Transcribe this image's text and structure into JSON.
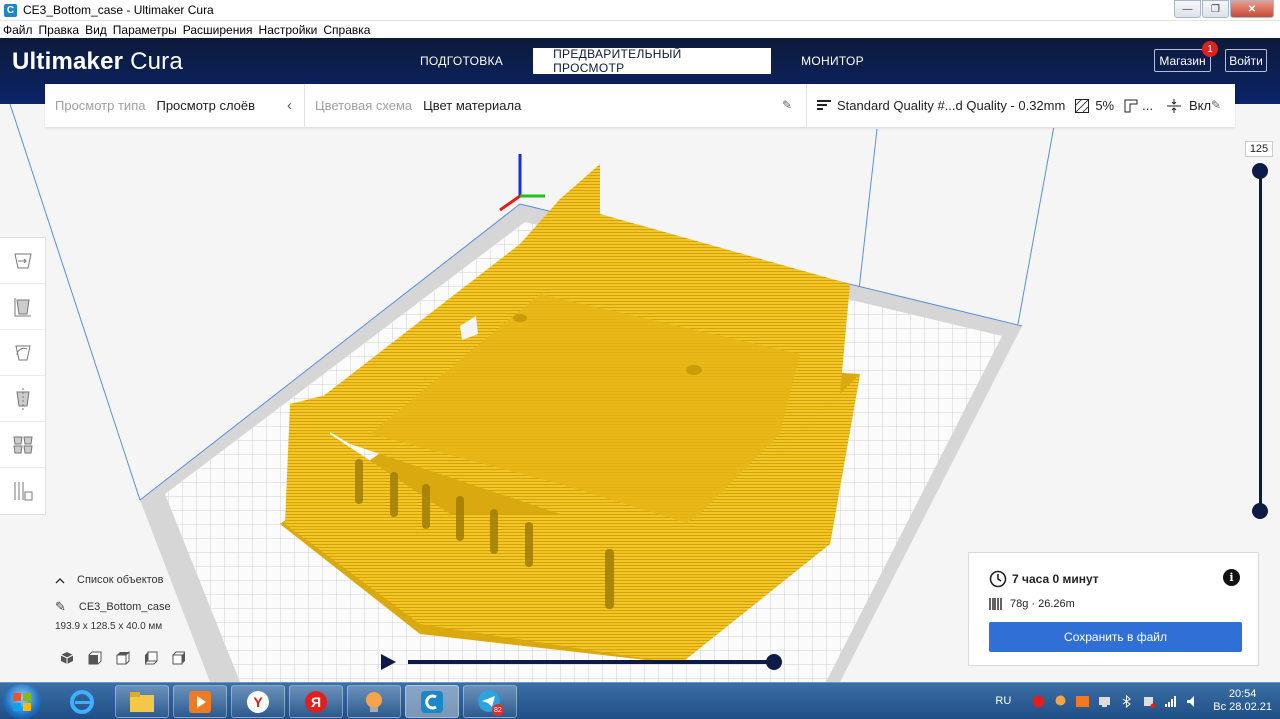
{
  "window": {
    "title": "CE3_Bottom_case - Ultimaker Cura",
    "app_icon_letter": "C",
    "controls": [
      "—",
      "❐",
      "✕"
    ]
  },
  "menu": [
    "Файл",
    "Правка",
    "Вид",
    "Параметры",
    "Расширения",
    "Настройки",
    "Справка"
  ],
  "header": {
    "logo_bold": "Ultimaker",
    "logo_light": "Cura",
    "tabs": [
      {
        "label": "ПОДГОТОВКА",
        "active": false
      },
      {
        "label": "ПРЕДВАРИТЕЛЬНЫЙ ПРОСМОТР",
        "active": true
      },
      {
        "label": "МОНИТОР",
        "active": false
      }
    ],
    "store_label": "Магазин",
    "store_badge": "1",
    "login_label": "Войти"
  },
  "view_options": {
    "view_type_label": "Просмотр типа",
    "view_type_value": "Просмотр слоёв",
    "color_scheme_label": "Цветовая схема",
    "color_scheme_value": "Цвет материала",
    "profile": "Standard Quality #...d Quality - 0.32mm",
    "infill": "5%",
    "support": "...",
    "adhesion": "Вкл"
  },
  "layer_slider": {
    "current_layer": "125",
    "level": 1.0
  },
  "objects": {
    "header_label": "Список объектов",
    "name": "CE3_Bottom_case",
    "dimensions": "193.9 x 128.5 x 40.0 мм"
  },
  "playback": {
    "progress": 1.0
  },
  "print_info": {
    "time": "7 часа 0 минут",
    "material": "78g · 26.26m",
    "save_label": "Сохранить в файл",
    "info_glyph": "i"
  },
  "taskbar": {
    "language": "RU",
    "time": "20:54",
    "date": "Вс 28.02.21",
    "telegram_badge": "82"
  },
  "colors": {
    "header_dark": "#0c1a3a",
    "accent_blue": "#2f6fd6",
    "model_yellow": "#f3c623",
    "build_plate": "#d9d9d9"
  }
}
